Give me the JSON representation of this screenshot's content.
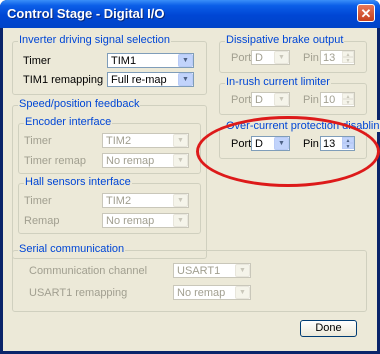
{
  "window": {
    "title": "Control Stage - Digital I/O",
    "close_glyph": "✕"
  },
  "inverter": {
    "title": "Inverter driving signal selection",
    "timer_label": "Timer",
    "timer_value": "TIM1",
    "remap_label": "TIM1 remapping",
    "remap_value": "Full re-map"
  },
  "speed": {
    "title": "Speed/position feedback",
    "encoder": {
      "title": "Encoder interface",
      "timer_label": "Timer",
      "timer_value": "TIM2",
      "remap_label": "Timer remap",
      "remap_value": "No remap"
    },
    "hall": {
      "title": "Hall sensors interface",
      "timer_label": "Timer",
      "timer_value": "TIM2",
      "remap_label": "Remap",
      "remap_value": "No remap"
    }
  },
  "brake": {
    "title": "Dissipative brake output",
    "port_label": "Port",
    "port_value": "D",
    "pin_label": "Pin",
    "pin_value": "13"
  },
  "inrush": {
    "title": "In-rush current limiter",
    "port_label": "Port",
    "port_value": "D",
    "pin_label": "Pin",
    "pin_value": "10"
  },
  "overcurrent": {
    "title": "Over-current protection disabling",
    "port_label": "Port",
    "port_value": "D",
    "pin_label": "Pin",
    "pin_value": "13"
  },
  "serial": {
    "title": "Serial communication",
    "channel_label": "Communication channel",
    "channel_value": "USART1",
    "remap_label": "USART1 remapping",
    "remap_value": "No remap"
  },
  "done_label": "Done",
  "colors": {
    "highlight_ellipse": "#dd1a1a",
    "titlebar": "#0046d4",
    "group_title": "#0046d5"
  }
}
